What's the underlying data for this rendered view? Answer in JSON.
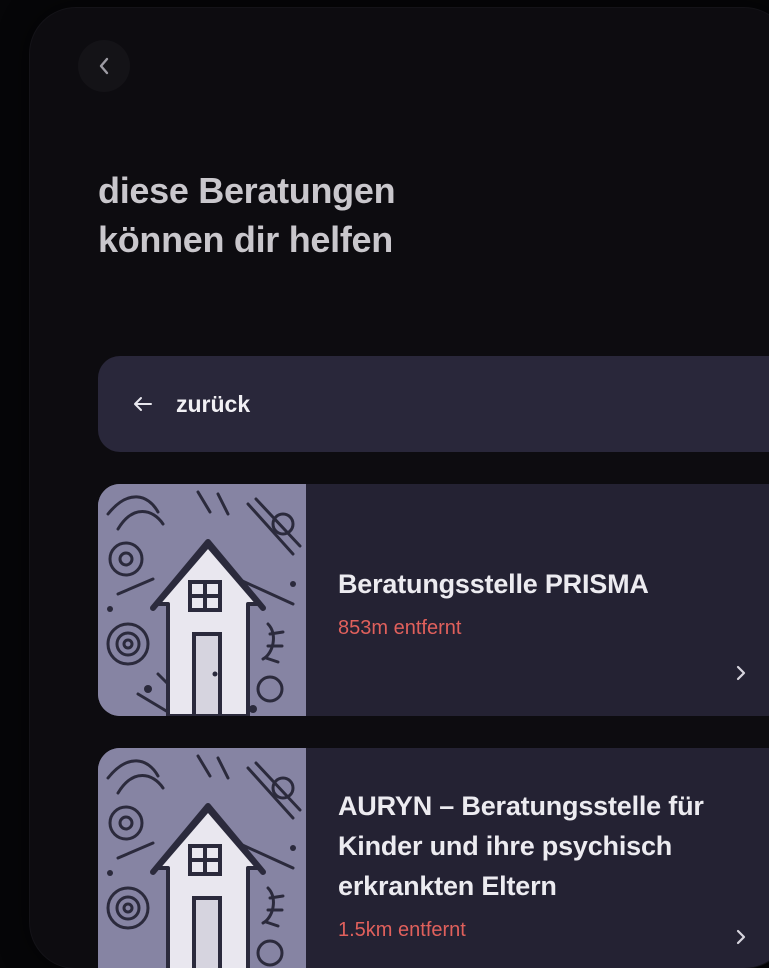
{
  "header": {
    "back_icon": "chevron-left-icon"
  },
  "page": {
    "title_line1": "diese Beratungen",
    "title_line2": "können dir helfen"
  },
  "back_row": {
    "icon": "arrow-left-icon",
    "label": "zurück"
  },
  "results": [
    {
      "name": "Beratungsstelle PRISMA",
      "distance": "853m entfernt",
      "thumbnail": "house-illustration"
    },
    {
      "name": "AURYN – Beratungsstelle für Kinder und ihre psychisch erkrankten Eltern",
      "distance": "1.5km entfernt",
      "thumbnail": "house-illustration"
    }
  ],
  "colors": {
    "background": "#0d0c10",
    "row_background": "#29273a",
    "card_background": "#242233",
    "title_text": "#c9c7cc",
    "accent_distance": "#e0605c",
    "thumbnail_base": "#8a89a6"
  }
}
